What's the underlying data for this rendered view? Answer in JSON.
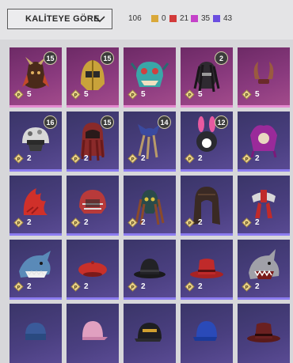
{
  "filter": {
    "sort_label": "KALİTEYE GÖRE"
  },
  "totals": {
    "total": "106",
    "counts": [
      {
        "color": "#d9a83a",
        "value": "0"
      },
      {
        "color": "#d23a3a",
        "value": "21"
      },
      {
        "color": "#c542c9",
        "value": "35"
      },
      {
        "color": "#6b4ee0",
        "value": "43"
      }
    ]
  },
  "rows": [
    [
      {
        "quality": "legendary",
        "item": "tribal-warrior-head-icon",
        "qty": "5",
        "badge": "15"
      },
      {
        "quality": "legendary",
        "item": "golden-helmet-icon",
        "qty": "5",
        "badge": "15"
      },
      {
        "quality": "legendary",
        "item": "cyan-monster-mask-icon",
        "qty": "5",
        "badge": ""
      },
      {
        "quality": "legendary",
        "item": "dreadlock-hunter-mask-icon",
        "qty": "5",
        "badge": "2"
      },
      {
        "quality": "legendary",
        "item": "horned-headpiece-icon",
        "qty": "5",
        "badge": ""
      }
    ],
    [
      {
        "quality": "epic",
        "item": "camo-helmet-icon",
        "qty": "2",
        "badge": "16"
      },
      {
        "quality": "epic",
        "item": "red-hair-hood-icon",
        "qty": "2",
        "badge": "15"
      },
      {
        "quality": "epic",
        "item": "feathered-cat-hat-icon",
        "qty": "2",
        "badge": "14"
      },
      {
        "quality": "epic",
        "item": "bunny-ear-hood-icon",
        "qty": "2",
        "badge": "12"
      },
      {
        "quality": "epic",
        "item": "purple-jester-hat-icon",
        "qty": "2",
        "badge": ""
      }
    ],
    [
      {
        "quality": "epic",
        "item": "red-mohawk-icon",
        "qty": "2",
        "badge": ""
      },
      {
        "quality": "epic",
        "item": "red-sports-helmet-icon",
        "qty": "2",
        "badge": ""
      },
      {
        "quality": "epic",
        "item": "tribal-mask-dreads-icon",
        "qty": "2",
        "badge": ""
      },
      {
        "quality": "epic",
        "item": "long-dark-hair-icon",
        "qty": "2",
        "badge": ""
      },
      {
        "quality": "epic",
        "item": "red-white-headwrap-icon",
        "qty": "2",
        "badge": ""
      }
    ],
    [
      {
        "quality": "epic",
        "item": "shark-hood-icon",
        "qty": "2",
        "badge": ""
      },
      {
        "quality": "epic",
        "item": "red-beret-icon",
        "qty": "2",
        "badge": ""
      },
      {
        "quality": "epic",
        "item": "black-bowler-hat-icon",
        "qty": "2",
        "badge": ""
      },
      {
        "quality": "epic",
        "item": "red-fedora-icon",
        "qty": "2",
        "badge": ""
      },
      {
        "quality": "epic",
        "item": "grey-shark-hood-icon",
        "qty": "2",
        "badge": ""
      }
    ],
    [
      {
        "quality": "epic",
        "item": "blue-knit-cap-icon",
        "qty": "",
        "badge": ""
      },
      {
        "quality": "epic",
        "item": "pink-cap-icon",
        "qty": "",
        "badge": ""
      },
      {
        "quality": "epic",
        "item": "black-gold-cap-icon",
        "qty": "",
        "badge": ""
      },
      {
        "quality": "epic",
        "item": "blue-baseball-cap-icon",
        "qty": "",
        "badge": ""
      },
      {
        "quality": "epic",
        "item": "dark-red-fedora-icon",
        "qty": "",
        "badge": ""
      }
    ]
  ]
}
